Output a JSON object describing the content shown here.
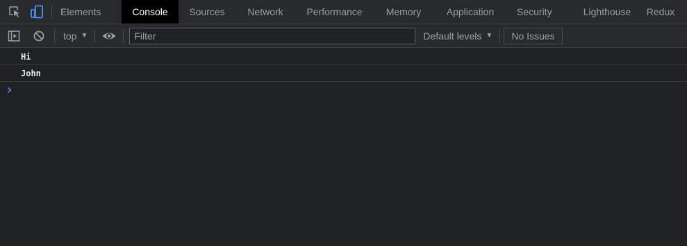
{
  "tabbar": {
    "inspect_icon": "inspect-element-icon",
    "device_icon": "device-toolbar-icon",
    "tabs": [
      {
        "label": "Elements",
        "active": false
      },
      {
        "label": "Console",
        "active": true
      },
      {
        "label": "Sources",
        "active": false
      },
      {
        "label": "Network",
        "active": false
      },
      {
        "label": "Performance",
        "active": false
      },
      {
        "label": "Memory",
        "active": false
      },
      {
        "label": "Application",
        "active": false
      },
      {
        "label": "Security",
        "active": false
      },
      {
        "label": "Lighthouse",
        "active": false
      },
      {
        "label": "Redux",
        "active": false
      }
    ]
  },
  "toolbar": {
    "sidebar_icon": "show-sidebar-icon",
    "clear_icon": "clear-console-icon",
    "context": "top",
    "eye_icon": "live-expression-eye-icon",
    "filter_placeholder": "Filter",
    "levels_label": "Default levels",
    "issues_label": "No Issues"
  },
  "console": {
    "messages": [
      "Hi",
      "John"
    ],
    "prompt_icon": "prompt-chevron-icon"
  },
  "colors": {
    "background": "#202124",
    "toolbar": "#292a2d",
    "active_tab": "#000000",
    "accent": "#4d8ff8",
    "text": "#e8eaed",
    "muted_text": "#9aa0a6"
  }
}
